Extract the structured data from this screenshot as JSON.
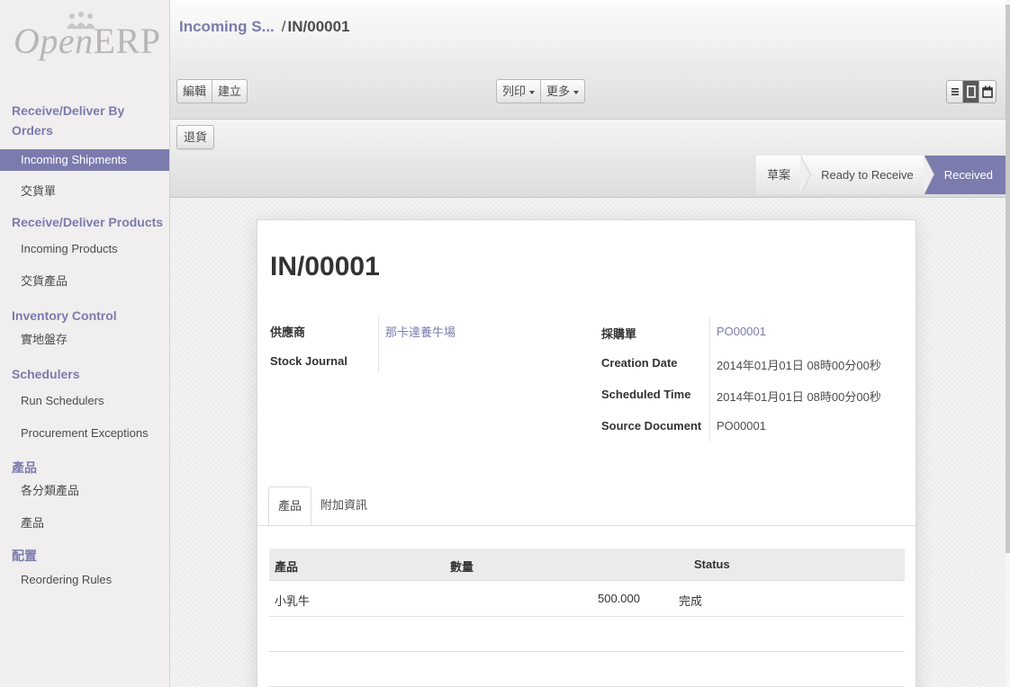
{
  "app": {
    "logo_word1": "Open",
    "logo_word2": "ERP",
    "accent_color": "#7c7bad"
  },
  "sidebar": {
    "sections": [
      {
        "title": "Receive/Deliver By Orders",
        "items": [
          "Incoming Shipments",
          "交貨單"
        ]
      },
      {
        "title": "Receive/Deliver Products",
        "items": [
          "Incoming Products",
          "交貨產品"
        ]
      },
      {
        "title": "Inventory Control",
        "items": [
          "實地盤存"
        ]
      },
      {
        "title": "Schedulers",
        "items": [
          "Run Schedulers",
          "Procurement Exceptions"
        ]
      },
      {
        "title": "產品",
        "items": [
          "各分類產品",
          "產品"
        ]
      },
      {
        "title": "配置",
        "items": [
          "Reordering Rules"
        ]
      }
    ],
    "active_item": "Incoming Shipments"
  },
  "header": {
    "breadcrumb_parent": "Incoming S...",
    "breadcrumb_separator": "/",
    "breadcrumb_current": "IN/00001",
    "edit_label": "編輯",
    "create_label": "建立",
    "print_label": "列印",
    "more_label": "更多",
    "view_icons": [
      "list-view-icon",
      "form-view-icon",
      "calendar-view-icon"
    ]
  },
  "statusbar": {
    "action_label": "退貨",
    "stages": [
      "草案",
      "Ready to Receive",
      "Received"
    ],
    "current_stage": "Received"
  },
  "form": {
    "title": "IN/00001",
    "left_fields": [
      {
        "label": "供應商",
        "value": "那卡達養牛場",
        "is_link": true
      },
      {
        "label": "Stock Journal",
        "value": ""
      }
    ],
    "right_fields": [
      {
        "label": "採購單",
        "value": "PO00001",
        "is_link": true
      },
      {
        "label": "Creation Date",
        "value": "2014年01月01日 08時00分00秒"
      },
      {
        "label": "Scheduled Time",
        "value": "2014年01月01日 08時00分00秒"
      },
      {
        "label": "Source Document",
        "value": "PO00001"
      }
    ],
    "tabs": [
      "產品",
      "附加資訊"
    ],
    "active_tab": "產品",
    "table": {
      "columns": [
        "產品",
        "數量",
        "Status"
      ],
      "rows": [
        {
          "product": "小乳牛",
          "quantity": "500.000",
          "status": "完成"
        }
      ]
    }
  }
}
